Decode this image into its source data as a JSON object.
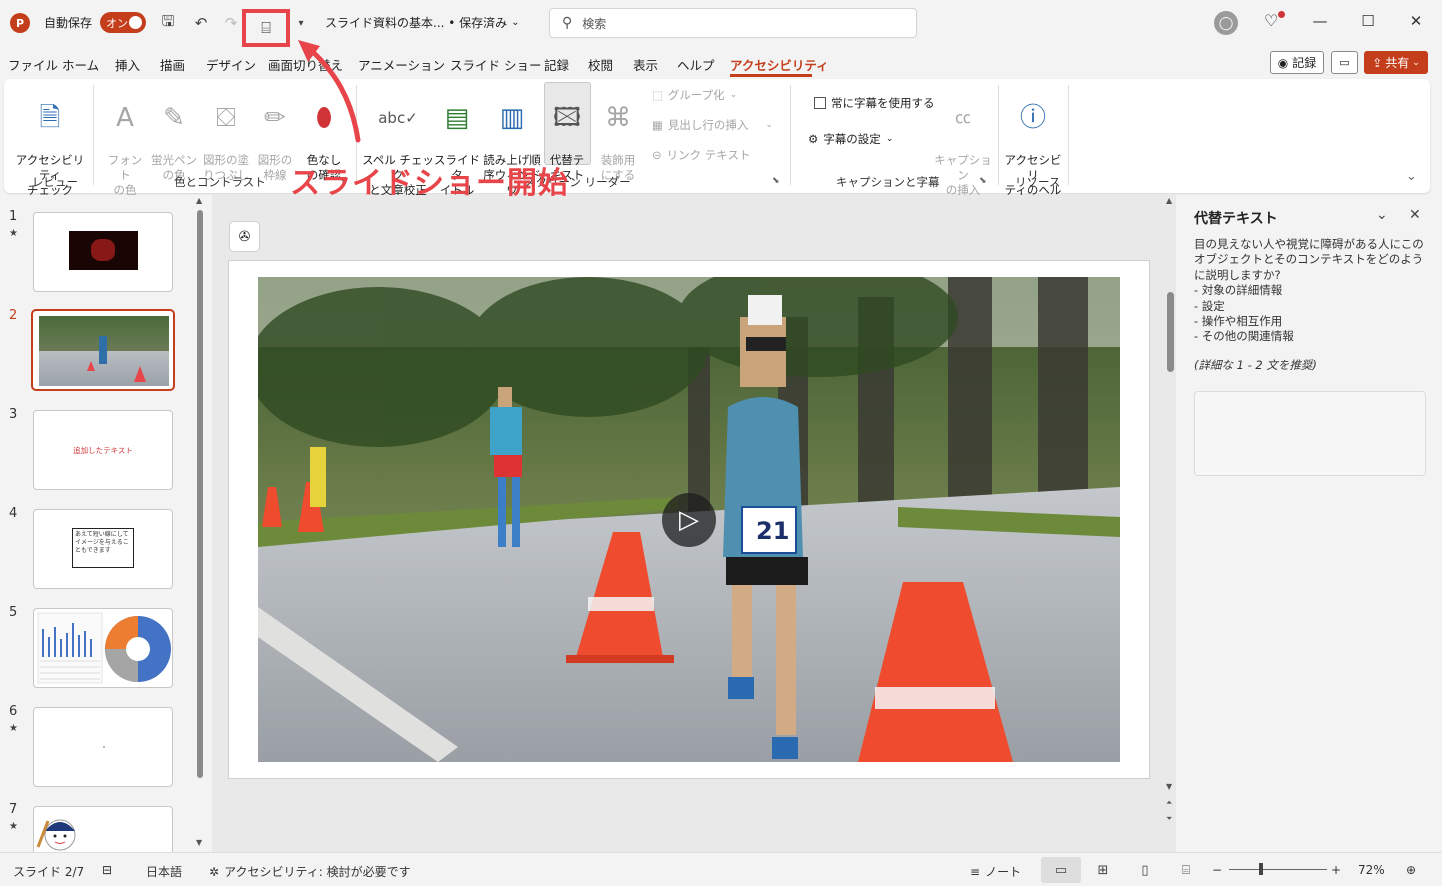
{
  "titlebar": {
    "app_icon": "P",
    "autosave_label": "自動保存",
    "autosave_state": "オン",
    "document_title": "スライド資料の基本... • 保存済み",
    "search_placeholder": "検索"
  },
  "menu_tabs": [
    "ファイル",
    "ホーム",
    "挿入",
    "描画",
    "デザイン",
    "画面切り替え",
    "アニメーション",
    "スライド ショー",
    "記録",
    "校閲",
    "表示",
    "ヘルプ",
    "アクセシビリティ"
  ],
  "active_tab": "アクセシビリティ",
  "header_buttons": {
    "record": "記録",
    "share": "共有"
  },
  "ribbon": {
    "accessibility_check": "アクセシビリティ\nチェック",
    "review_group": "レビュー",
    "font_color": "フォント\nの色",
    "highlight_color": "蛍光ペン\nの色",
    "shape_fill": "図形の塗\nりつぶし",
    "shape_outline": "図形の\n枠線",
    "colorless_check": "色なし\nの確認",
    "color_group": "色とコントラスト",
    "spell_check": "スペル チェック\nと文章校正",
    "slide_title": "スライド タ\nイトル",
    "reading_order": "読み上げ順\n序ウィンドウ",
    "alt_text": "代替テ\nキスト",
    "decorative": "装飾用\nにする",
    "group": "グループ化",
    "insert_header_row": "見出し行の挿入",
    "link_text": "リンク テキスト",
    "screen_reader_group": "スクリーン リーダー",
    "always_captions": "常に字幕を使用する",
    "caption_settings": "字幕の設定",
    "insert_captions": "キャプション\nの挿入",
    "captions_group": "キャプションと字幕",
    "accessibility_help": "アクセシビリ\nティのヘルプ",
    "resources_group": "リソース"
  },
  "annotation": {
    "callout": "スライドショー開始",
    "color": "#e8454a"
  },
  "slides": [
    {
      "num": "1",
      "star": true
    },
    {
      "num": "2",
      "star": false,
      "selected": true
    },
    {
      "num": "3",
      "star": false,
      "text": "追加したテキスト"
    },
    {
      "num": "4",
      "star": false,
      "text": "あえて短い線にしてイメージを与えることもできます"
    },
    {
      "num": "5",
      "star": false
    },
    {
      "num": "6",
      "star": true
    },
    {
      "num": "7",
      "star": true
    }
  ],
  "alt_pane": {
    "title": "代替テキスト",
    "description": "目の見えない人や視覚に障碍がある人にこのオブジェクトとそのコンテキストをどのように説明しますか?",
    "items": [
      "- 対象の詳細情報",
      "- 設定",
      "- 操作や相互作用",
      "- その他の関連情報"
    ],
    "hint": "(詳細な 1 - 2 文を推奨)"
  },
  "status": {
    "slide_info": "スライド 2/7",
    "language": "日本語",
    "accessibility": "アクセシビリティ: 検討が必要です",
    "notes": "ノート",
    "zoom": "72%"
  },
  "colors": {
    "accent": "#c43e1c",
    "annotation": "#e8454a"
  }
}
